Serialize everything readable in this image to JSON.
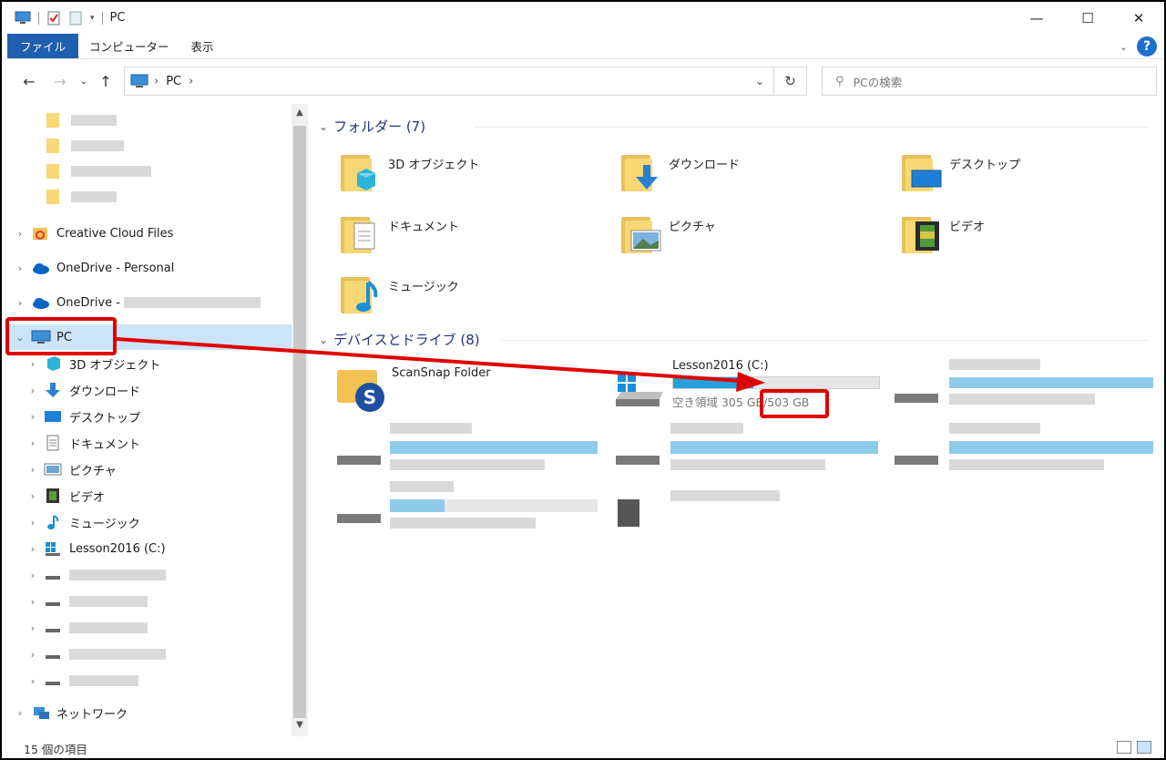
{
  "window": {
    "title": "PC",
    "controls": [
      "—",
      "☐",
      "✕"
    ]
  },
  "ribbon": {
    "tabs": [
      "ファイル",
      "コンピューター",
      "表示"
    ],
    "help": "?"
  },
  "address": {
    "crumb": "PC",
    "sep": "›"
  },
  "search": {
    "placeholder": "PCの検索"
  },
  "sidebar": {
    "items": [
      {
        "label": "Creative Cloud Files"
      },
      {
        "label": "OneDrive - Personal"
      },
      {
        "label": "OneDrive -"
      },
      {
        "label": "PC"
      },
      {
        "label": "3D オブジェクト"
      },
      {
        "label": "ダウンロード"
      },
      {
        "label": "デスクトップ"
      },
      {
        "label": "ドキュメント"
      },
      {
        "label": "ピクチャ"
      },
      {
        "label": "ビデオ"
      },
      {
        "label": "ミュージック"
      },
      {
        "label": "Lesson2016 (C:)"
      },
      {
        "label": "ネットワーク"
      }
    ]
  },
  "content": {
    "folders_header": "フォルダー (7)",
    "folders": [
      "3D オブジェクト",
      "ダウンロード",
      "デスクトップ",
      "ドキュメント",
      "ピクチャ",
      "ビデオ",
      "ミュージック"
    ],
    "devices_header": "デバイスとドライブ (8)",
    "scansnap": "ScanSnap Folder",
    "drive": {
      "name": "Lesson2016 (C:)",
      "free": "空き領域 305 GB/503 GB",
      "used_fraction": 0.39
    }
  },
  "status": {
    "count": "15 個の項目"
  },
  "colors": {
    "accent": "#1f5fb0",
    "annotation": "#e00000",
    "drive_fill": "#26a0da"
  }
}
